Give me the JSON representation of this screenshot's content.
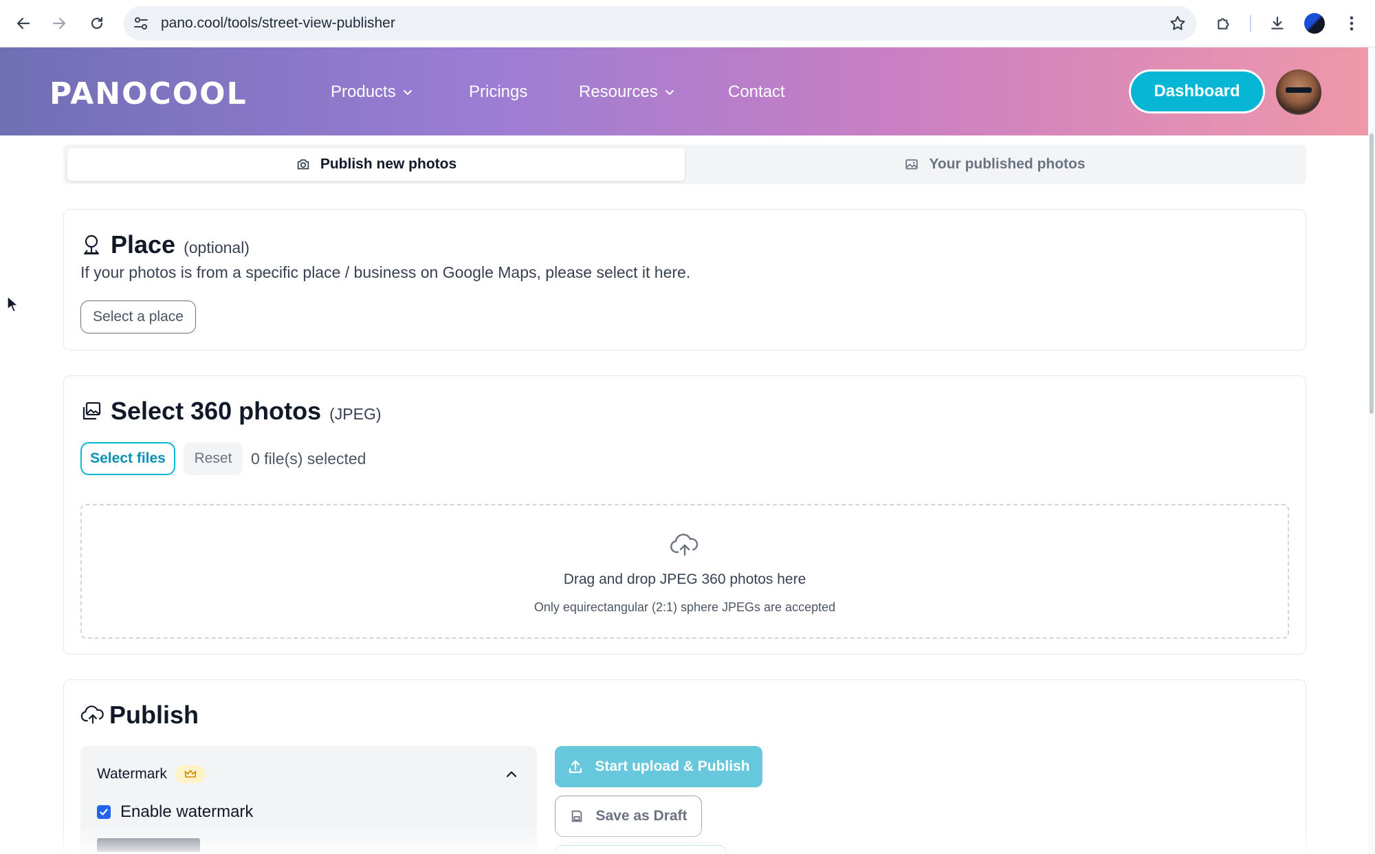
{
  "browser": {
    "url": "pano.cool/tools/street-view-publisher"
  },
  "header": {
    "logo": "PANOCOOL",
    "nav": [
      {
        "label": "Products",
        "has_dropdown": true
      },
      {
        "label": "Pricings",
        "has_dropdown": false
      },
      {
        "label": "Resources",
        "has_dropdown": true
      },
      {
        "label": "Contact",
        "has_dropdown": false
      }
    ],
    "dashboard_label": "Dashboard"
  },
  "tabs": {
    "publish_new": "Publish new photos",
    "published": "Your published photos",
    "active": "publish_new"
  },
  "place": {
    "title": "Place",
    "qualifier": "(optional)",
    "description": "If your photos is from a specific place / business on Google Maps, please select it here.",
    "select_label": "Select a place"
  },
  "photos": {
    "title": "Select 360 photos",
    "qualifier": "(JPEG)",
    "select_files_label": "Select files",
    "reset_label": "Reset",
    "file_count": "0 file(s) selected",
    "dropzone_main": "Drag and drop JPEG 360 photos here",
    "dropzone_sub": "Only equirectangular (2:1) sphere JPEGs are accepted"
  },
  "publish": {
    "title": "Publish",
    "watermark_label": "Watermark",
    "enable_watermark_label": "Enable watermark",
    "enable_watermark_checked": true,
    "start_upload_label": "Start upload & Publish",
    "save_draft_label": "Save as Draft"
  },
  "colors": {
    "accent": "#06b6d4",
    "primary_disabled": "#67c7dd",
    "checkbox": "#2563eb",
    "header_gradient_start": "#6f6fb4",
    "header_gradient_end": "#ef98aa"
  },
  "icons": {
    "back": "arrow-left-icon",
    "forward": "arrow-right-icon",
    "reload": "reload-icon",
    "site_info": "tune-icon",
    "bookmark": "star-icon",
    "extensions": "puzzle-icon",
    "downloads": "download-icon",
    "menu": "kebab-menu-icon",
    "place": "map-pin-icon",
    "photos": "images-icon",
    "upload_cloud": "cloud-upload-icon",
    "crown": "crown-icon"
  }
}
